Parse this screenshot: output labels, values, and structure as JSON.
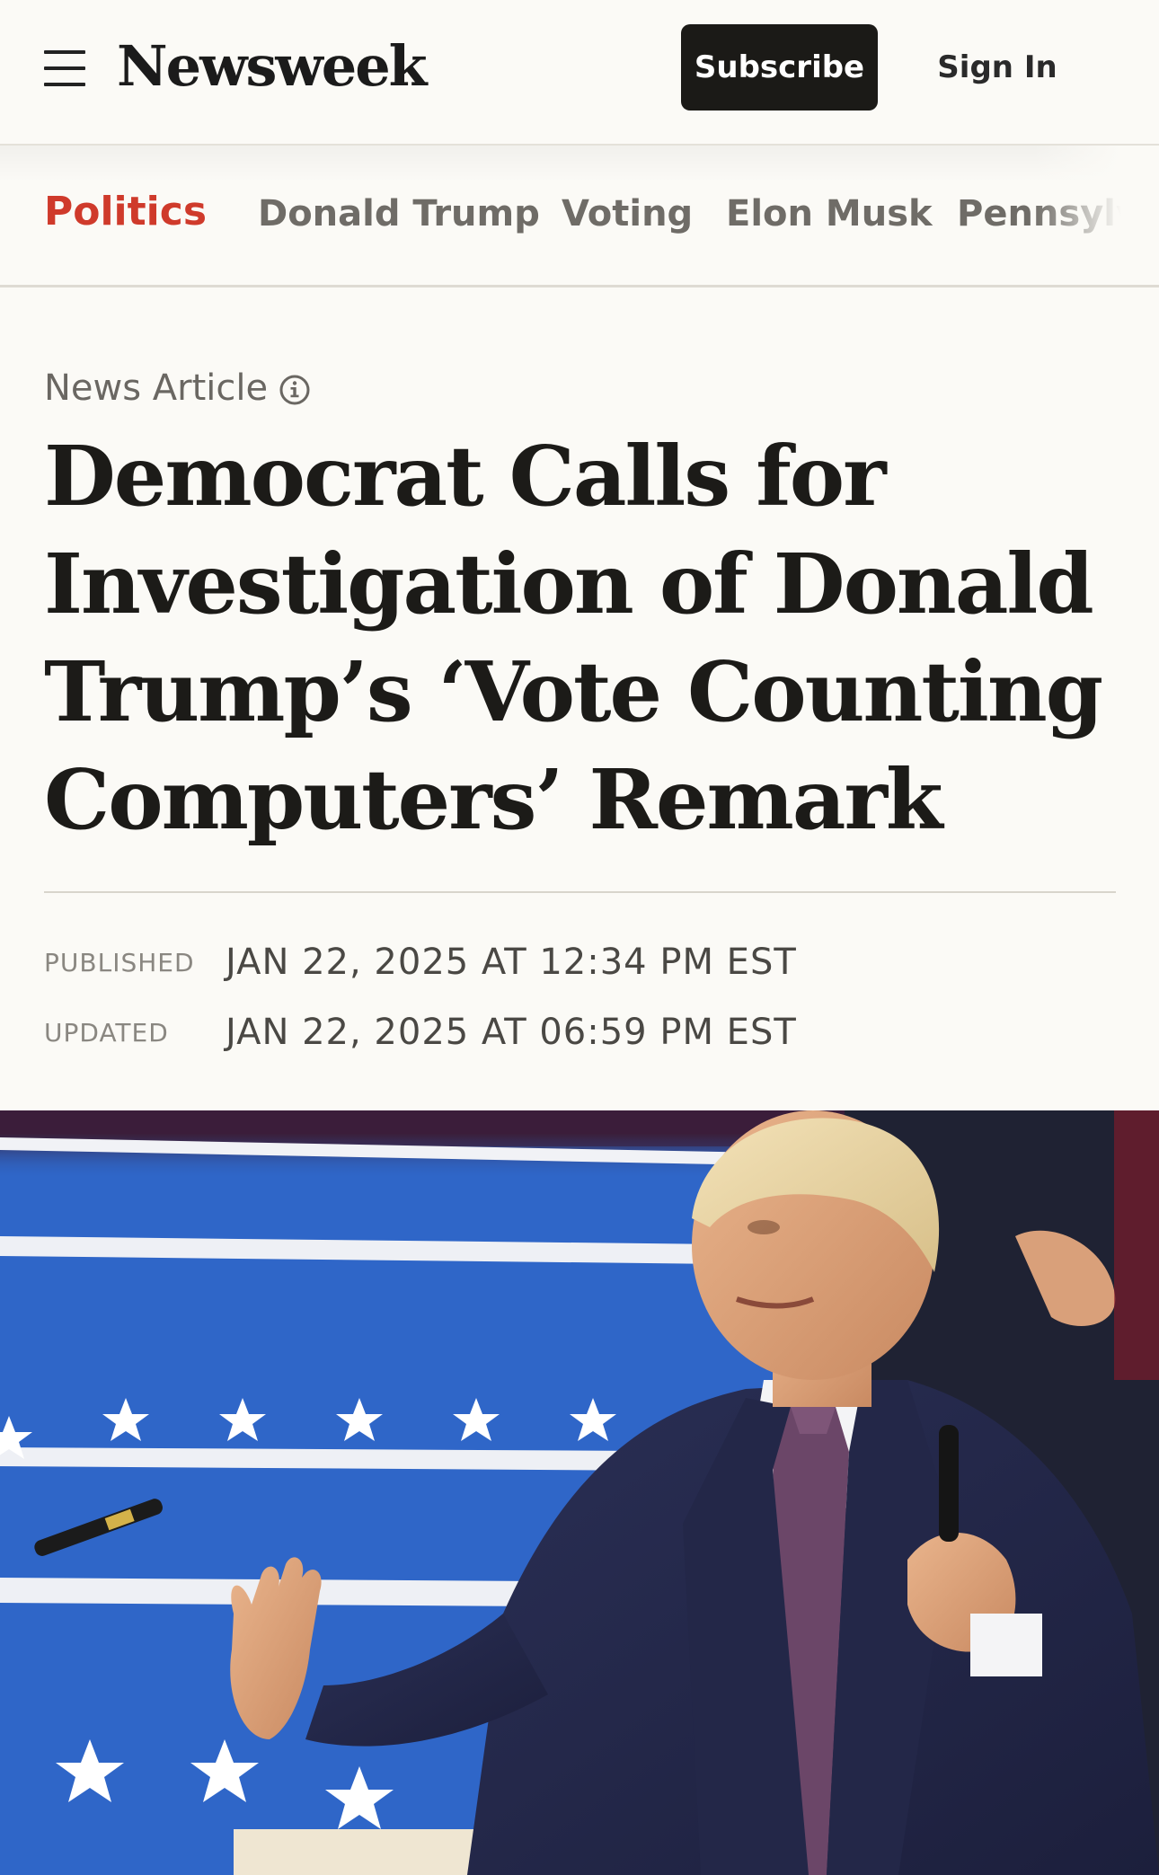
{
  "header": {
    "menu_icon": "hamburger-menu-icon",
    "logo_text": "Newsweek",
    "subscribe_label": "Subscribe",
    "signin_label": "Sign In"
  },
  "category_nav": {
    "items": [
      {
        "label": "Politics",
        "active": true
      },
      {
        "label": "Donald Trump",
        "active": false
      },
      {
        "label": "Voting",
        "active": false
      },
      {
        "label": "Elon Musk",
        "active": false
      },
      {
        "label": "Pennsylv",
        "active": false
      }
    ]
  },
  "article": {
    "type_label": "News Article",
    "type_icon": "info-icon",
    "headline": "Democrat Calls for Investigation of Donald Trump’s ‘Vote Counting Computers’ Remark",
    "published_label": "PUBLISHED",
    "published_value": "JAN 22, 2025 AT 12:34 PM EST",
    "updated_label": "UPDATED",
    "updated_value": "JAN 22, 2025 AT 06:59 PM EST"
  },
  "colors": {
    "background": "#fbfaf6",
    "active_category": "#cf3a2b",
    "subscribe_bg": "#1b1a17",
    "inactive_category": "#6f6c67"
  }
}
